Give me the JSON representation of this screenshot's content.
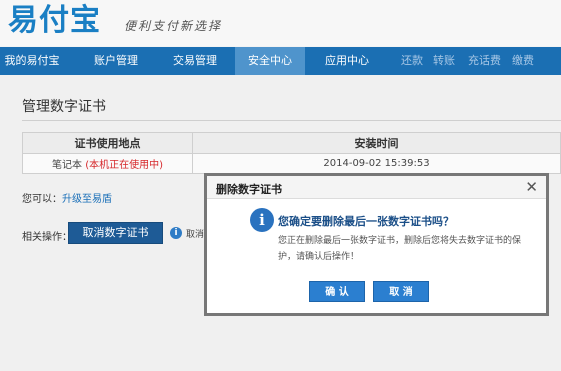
{
  "header": {
    "logo": "易付宝",
    "slogan": "便利支付新选择"
  },
  "nav": {
    "items": [
      {
        "label": "我的易付宝"
      },
      {
        "label": "账户管理"
      },
      {
        "label": "交易管理"
      },
      {
        "label": "安全中心",
        "active": true
      },
      {
        "label": "应用中心"
      }
    ],
    "links": [
      {
        "label": "还款"
      },
      {
        "label": "转账"
      },
      {
        "label": "充话费"
      },
      {
        "label": "缴费"
      }
    ]
  },
  "page": {
    "title": "管理数字证书",
    "table": {
      "headers": [
        "证书使用地点",
        "安装时间"
      ],
      "row": {
        "location": "笔记本",
        "in_use": "(本机正在使用中)",
        "install_time": "2014-09-02 15:39:53"
      }
    },
    "can_label": "您可以：",
    "upgrade_link": "升级至易盾",
    "related_label": "相关操作：",
    "cancel_cert_button": "取消数字证书",
    "hint_text": "取消数"
  },
  "dialog": {
    "title": "删除数字证书",
    "close_glyph": "✕",
    "info_glyph": "i",
    "question": "您确定要删除最后一张数字证书吗？",
    "description": "您正在删除最后一张数字证书，删除后您将失去数字证书的保护，请确认后操作！",
    "confirm_label": "确 认",
    "cancel_label": "取 消"
  },
  "colors": {
    "nav_bg": "#1b6fb3",
    "nav_active": "#4f94cc",
    "brand_blue": "#1a7fc4",
    "button_blue": "#2b7fd0",
    "warning_red": "#d6282b"
  }
}
